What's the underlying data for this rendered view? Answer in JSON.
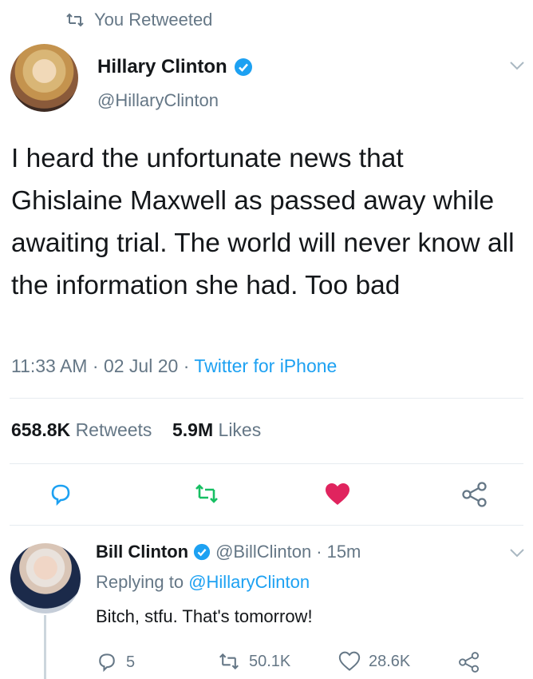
{
  "retweet_header": {
    "label": "You Retweeted",
    "icon": "retweet-icon"
  },
  "main_tweet": {
    "author_name": "Hillary Clinton",
    "handle": "@HillaryClinton",
    "verified": true,
    "text": "I heard the unfortunate news that Ghislaine Maxwell as passed away while awaiting trial. The world will never know all the information she had. Too bad",
    "time": "11:33 AM",
    "separator": "·",
    "date": "02 Jul 20",
    "source": "Twitter for iPhone",
    "retweets_count": "658.8K",
    "retweets_label": "Retweets",
    "likes_count": "5.9M",
    "likes_label": "Likes",
    "actions": [
      "reply-icon",
      "retweet-icon",
      "like-heart-icon",
      "share-icon"
    ],
    "liked": true
  },
  "reply_tweet": {
    "author_name": "Bill Clinton",
    "handle": "@BillClinton",
    "separator": "·",
    "time_ago": "15m",
    "replying_prefix": "Replying to",
    "replying_to": "@HillaryClinton",
    "text": "Bitch, stfu. That's tomorrow!",
    "reply_count": "5",
    "retweet_count": "50.1K",
    "like_count": "28.6K"
  },
  "colors": {
    "accent": "#1da1f2",
    "retweet_green": "#17bf63",
    "like_red": "#e0245e",
    "secondary_text": "#657786"
  }
}
